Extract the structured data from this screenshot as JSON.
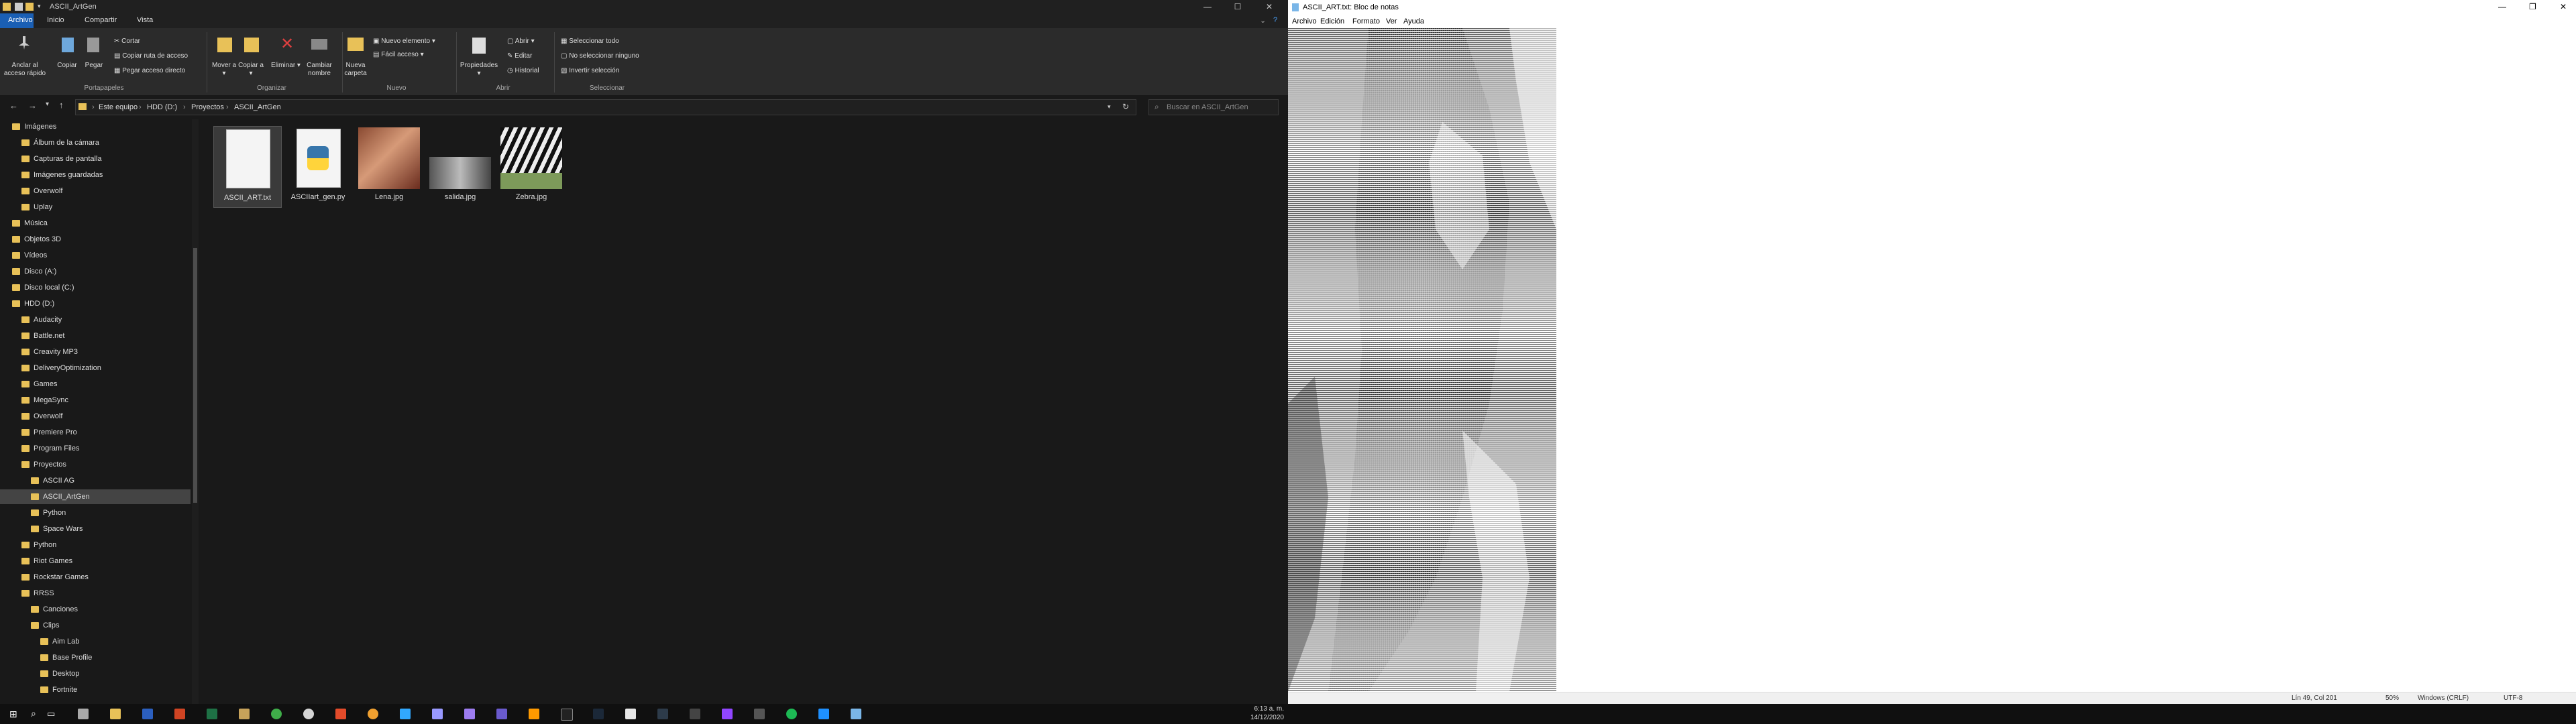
{
  "explorer": {
    "title": "ASCII_ArtGen",
    "tabs": [
      "Archivo",
      "Inicio",
      "Compartir",
      "Vista"
    ],
    "ribbon": {
      "anclar": "Anclar al acceso rápido",
      "copiar": "Copiar",
      "pegar": "Pegar",
      "cortar": "Cortar",
      "copiar_ruta": "Copiar ruta de acceso",
      "pegar_acceso": "Pegar acceso directo",
      "mover": "Mover a ▾",
      "copiar_a": "Copiar a ▾",
      "eliminar": "Eliminar ▾",
      "cambiar_nombre": "Cambiar nombre",
      "nueva_carpeta": "Nueva carpeta",
      "nuevo_elemento": "Nuevo elemento ▾",
      "facil_acceso": "Fácil acceso ▾",
      "propiedades": "Propiedades ▾",
      "abrir": "Abrir ▾",
      "editar": "Editar",
      "historial": "Historial",
      "seleccionar_todo": "Seleccionar todo",
      "no_seleccionar": "No seleccionar ninguno",
      "invertir": "Invertir selección",
      "groups": [
        "Portapapeles",
        "Organizar",
        "Nuevo",
        "Abrir",
        "Seleccionar"
      ]
    },
    "breadcrumb": [
      "Este equipo",
      "HDD (D:)",
      "Proyectos",
      "ASCII_ArtGen"
    ],
    "search_placeholder": "Buscar en ASCII_ArtGen",
    "nav": [
      {
        "label": "Imágenes",
        "indent": 1
      },
      {
        "label": "Álbum de la cámara",
        "indent": 2
      },
      {
        "label": "Capturas de pantalla",
        "indent": 2
      },
      {
        "label": "Imágenes guardadas",
        "indent": 2
      },
      {
        "label": "Overwolf",
        "indent": 2
      },
      {
        "label": "Uplay",
        "indent": 2
      },
      {
        "label": "Música",
        "indent": 1
      },
      {
        "label": "Objetos 3D",
        "indent": 1
      },
      {
        "label": "Vídeos",
        "indent": 1
      },
      {
        "label": "Disco (A:)",
        "indent": 1
      },
      {
        "label": "Disco local (C:)",
        "indent": 1
      },
      {
        "label": "HDD (D:)",
        "indent": 1
      },
      {
        "label": "Audacity",
        "indent": 2
      },
      {
        "label": "Battle.net",
        "indent": 2
      },
      {
        "label": "Creavity MP3",
        "indent": 2
      },
      {
        "label": "DeliveryOptimization",
        "indent": 2
      },
      {
        "label": "Games",
        "indent": 2
      },
      {
        "label": "MegaSync",
        "indent": 2
      },
      {
        "label": "Overwolf",
        "indent": 2
      },
      {
        "label": "Premiere Pro",
        "indent": 2
      },
      {
        "label": "Program Files",
        "indent": 2
      },
      {
        "label": "Proyectos",
        "indent": 2
      },
      {
        "label": "ASCII AG",
        "indent": 3
      },
      {
        "label": "ASCII_ArtGen",
        "indent": 3,
        "selected": true
      },
      {
        "label": "Python",
        "indent": 3
      },
      {
        "label": "Space Wars",
        "indent": 3
      },
      {
        "label": "Python",
        "indent": 2
      },
      {
        "label": "Riot Games",
        "indent": 2
      },
      {
        "label": "Rockstar Games",
        "indent": 2
      },
      {
        "label": "RRSS",
        "indent": 2
      },
      {
        "label": "Canciones",
        "indent": 3
      },
      {
        "label": "Clips",
        "indent": 3
      },
      {
        "label": "Aim Lab",
        "indent": 4
      },
      {
        "label": "Base Profile",
        "indent": 4
      },
      {
        "label": "Desktop",
        "indent": 4
      },
      {
        "label": "Fortnite",
        "indent": 4
      }
    ],
    "files": [
      {
        "name": "ASCII_ART.txt",
        "kind": "txt",
        "selected": true
      },
      {
        "name": "ASCIIart_gen.py",
        "kind": "py"
      },
      {
        "name": "Lena.jpg",
        "kind": "img-lena"
      },
      {
        "name": "salida.jpg",
        "kind": "img-salida"
      },
      {
        "name": "Zebra.jpg",
        "kind": "img-zebra"
      }
    ]
  },
  "notepad": {
    "title": "ASCII_ART.txt: Bloc de notas",
    "menu": [
      "Archivo",
      "Edición",
      "Formato",
      "Ver",
      "Ayuda"
    ],
    "status": {
      "position": "Lín 49, Col 201",
      "zoom": "50%",
      "eol": "Windows (CRLF)",
      "encoding": "UTF-8"
    }
  },
  "taskbar": {
    "time": "6:13 a. m.",
    "date": "14/12/2020"
  }
}
